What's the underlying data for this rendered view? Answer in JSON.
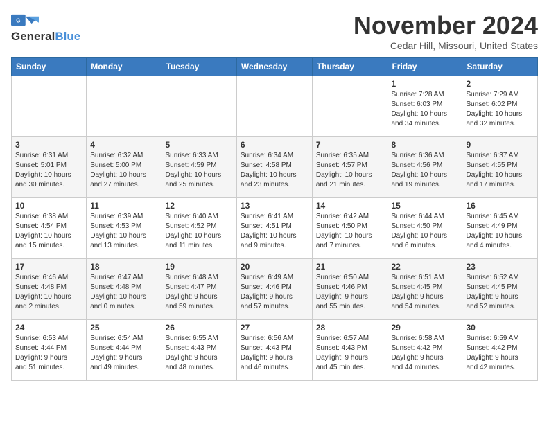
{
  "header": {
    "logo_line1": "General",
    "logo_line2": "Blue",
    "month": "November 2024",
    "location": "Cedar Hill, Missouri, United States"
  },
  "weekdays": [
    "Sunday",
    "Monday",
    "Tuesday",
    "Wednesday",
    "Thursday",
    "Friday",
    "Saturday"
  ],
  "weeks": [
    [
      {
        "day": "",
        "content": ""
      },
      {
        "day": "",
        "content": ""
      },
      {
        "day": "",
        "content": ""
      },
      {
        "day": "",
        "content": ""
      },
      {
        "day": "",
        "content": ""
      },
      {
        "day": "1",
        "content": "Sunrise: 7:28 AM\nSunset: 6:03 PM\nDaylight: 10 hours\nand 34 minutes."
      },
      {
        "day": "2",
        "content": "Sunrise: 7:29 AM\nSunset: 6:02 PM\nDaylight: 10 hours\nand 32 minutes."
      }
    ],
    [
      {
        "day": "3",
        "content": "Sunrise: 6:31 AM\nSunset: 5:01 PM\nDaylight: 10 hours\nand 30 minutes."
      },
      {
        "day": "4",
        "content": "Sunrise: 6:32 AM\nSunset: 5:00 PM\nDaylight: 10 hours\nand 27 minutes."
      },
      {
        "day": "5",
        "content": "Sunrise: 6:33 AM\nSunset: 4:59 PM\nDaylight: 10 hours\nand 25 minutes."
      },
      {
        "day": "6",
        "content": "Sunrise: 6:34 AM\nSunset: 4:58 PM\nDaylight: 10 hours\nand 23 minutes."
      },
      {
        "day": "7",
        "content": "Sunrise: 6:35 AM\nSunset: 4:57 PM\nDaylight: 10 hours\nand 21 minutes."
      },
      {
        "day": "8",
        "content": "Sunrise: 6:36 AM\nSunset: 4:56 PM\nDaylight: 10 hours\nand 19 minutes."
      },
      {
        "day": "9",
        "content": "Sunrise: 6:37 AM\nSunset: 4:55 PM\nDaylight: 10 hours\nand 17 minutes."
      }
    ],
    [
      {
        "day": "10",
        "content": "Sunrise: 6:38 AM\nSunset: 4:54 PM\nDaylight: 10 hours\nand 15 minutes."
      },
      {
        "day": "11",
        "content": "Sunrise: 6:39 AM\nSunset: 4:53 PM\nDaylight: 10 hours\nand 13 minutes."
      },
      {
        "day": "12",
        "content": "Sunrise: 6:40 AM\nSunset: 4:52 PM\nDaylight: 10 hours\nand 11 minutes."
      },
      {
        "day": "13",
        "content": "Sunrise: 6:41 AM\nSunset: 4:51 PM\nDaylight: 10 hours\nand 9 minutes."
      },
      {
        "day": "14",
        "content": "Sunrise: 6:42 AM\nSunset: 4:50 PM\nDaylight: 10 hours\nand 7 minutes."
      },
      {
        "day": "15",
        "content": "Sunrise: 6:44 AM\nSunset: 4:50 PM\nDaylight: 10 hours\nand 6 minutes."
      },
      {
        "day": "16",
        "content": "Sunrise: 6:45 AM\nSunset: 4:49 PM\nDaylight: 10 hours\nand 4 minutes."
      }
    ],
    [
      {
        "day": "17",
        "content": "Sunrise: 6:46 AM\nSunset: 4:48 PM\nDaylight: 10 hours\nand 2 minutes."
      },
      {
        "day": "18",
        "content": "Sunrise: 6:47 AM\nSunset: 4:48 PM\nDaylight: 10 hours\nand 0 minutes."
      },
      {
        "day": "19",
        "content": "Sunrise: 6:48 AM\nSunset: 4:47 PM\nDaylight: 9 hours\nand 59 minutes."
      },
      {
        "day": "20",
        "content": "Sunrise: 6:49 AM\nSunset: 4:46 PM\nDaylight: 9 hours\nand 57 minutes."
      },
      {
        "day": "21",
        "content": "Sunrise: 6:50 AM\nSunset: 4:46 PM\nDaylight: 9 hours\nand 55 minutes."
      },
      {
        "day": "22",
        "content": "Sunrise: 6:51 AM\nSunset: 4:45 PM\nDaylight: 9 hours\nand 54 minutes."
      },
      {
        "day": "23",
        "content": "Sunrise: 6:52 AM\nSunset: 4:45 PM\nDaylight: 9 hours\nand 52 minutes."
      }
    ],
    [
      {
        "day": "24",
        "content": "Sunrise: 6:53 AM\nSunset: 4:44 PM\nDaylight: 9 hours\nand 51 minutes."
      },
      {
        "day": "25",
        "content": "Sunrise: 6:54 AM\nSunset: 4:44 PM\nDaylight: 9 hours\nand 49 minutes."
      },
      {
        "day": "26",
        "content": "Sunrise: 6:55 AM\nSunset: 4:43 PM\nDaylight: 9 hours\nand 48 minutes."
      },
      {
        "day": "27",
        "content": "Sunrise: 6:56 AM\nSunset: 4:43 PM\nDaylight: 9 hours\nand 46 minutes."
      },
      {
        "day": "28",
        "content": "Sunrise: 6:57 AM\nSunset: 4:43 PM\nDaylight: 9 hours\nand 45 minutes."
      },
      {
        "day": "29",
        "content": "Sunrise: 6:58 AM\nSunset: 4:42 PM\nDaylight: 9 hours\nand 44 minutes."
      },
      {
        "day": "30",
        "content": "Sunrise: 6:59 AM\nSunset: 4:42 PM\nDaylight: 9 hours\nand 42 minutes."
      }
    ]
  ]
}
